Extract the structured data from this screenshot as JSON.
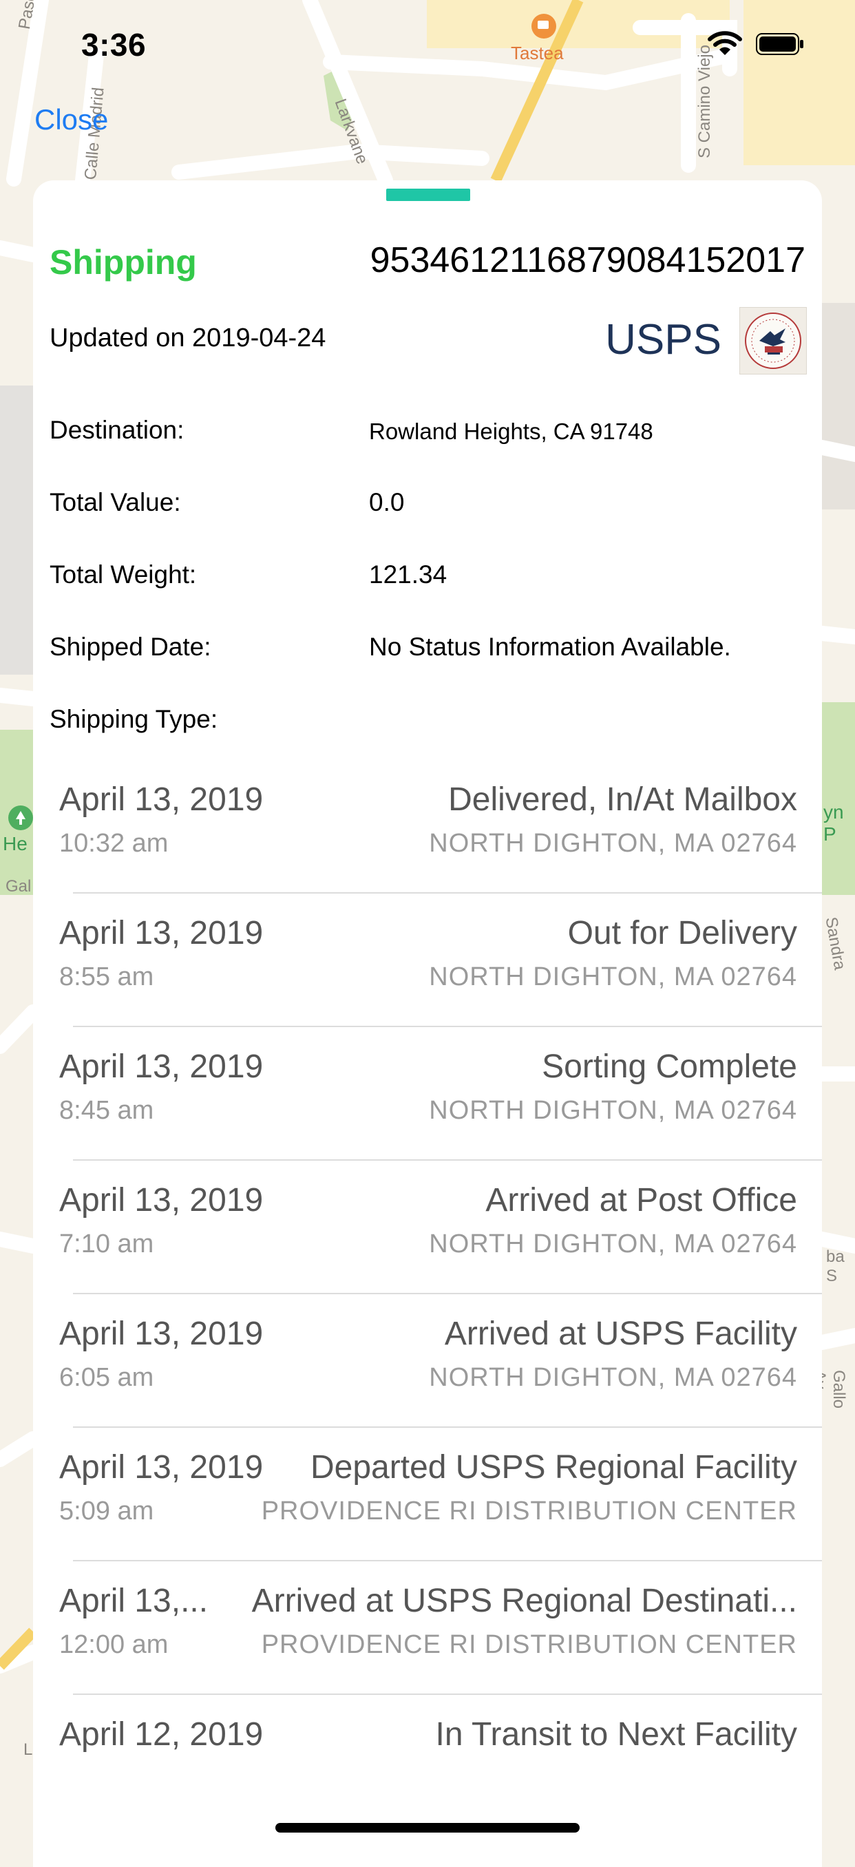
{
  "status_bar": {
    "time": "3:36"
  },
  "map": {
    "labels": [
      "Paseo Azul",
      "Calle Madrid",
      "Larkvane",
      "Tastea",
      "S Camino Viejo",
      "He",
      "Gal",
      "yn P",
      "Sandra Glen Dr",
      "ba S",
      "Gallo Av",
      "L"
    ]
  },
  "nav": {
    "close_label": "Close"
  },
  "shipment": {
    "status": "Shipping",
    "tracking_number": "9534612116879084152017",
    "updated": "Updated on 2019-04-24",
    "carrier": "USPS",
    "carrier_logo_icon": "usps-eagle-seal-icon",
    "details": [
      {
        "label": "Destination:",
        "value": "Rowland Heights, CA 91748"
      },
      {
        "label": "Total Value:",
        "value": "0.0"
      },
      {
        "label": "Total Weight:",
        "value": "121.34"
      },
      {
        "label": "Shipped Date:",
        "value": "No Status Information Available."
      },
      {
        "label": "Shipping Type:",
        "value": ""
      }
    ]
  },
  "events": [
    {
      "date": "April 13, 2019",
      "time": "10:32 am",
      "status": "Delivered, In/At Mailbox",
      "location": "NORTH DIGHTON, MA 02764"
    },
    {
      "date": "April 13, 2019",
      "time": "8:55 am",
      "status": "Out for Delivery",
      "location": "NORTH DIGHTON, MA 02764"
    },
    {
      "date": "April 13, 2019",
      "time": "8:45 am",
      "status": "Sorting Complete",
      "location": "NORTH DIGHTON, MA 02764"
    },
    {
      "date": "April 13, 2019",
      "time": "7:10 am",
      "status": "Arrived at Post Office",
      "location": "NORTH DIGHTON, MA 02764"
    },
    {
      "date": "April 13, 2019",
      "time": "6:05 am",
      "status": "Arrived at USPS Facility",
      "location": "NORTH DIGHTON, MA 02764"
    },
    {
      "date": "April 13, 2019",
      "time": "5:09 am",
      "status": "Departed USPS Regional Facility",
      "location": "PROVIDENCE RI DISTRIBUTION CENTER"
    },
    {
      "date": "April 13,...",
      "time": "12:00 am",
      "status": "Arrived at USPS Regional Destinati...",
      "location": "PROVIDENCE RI DISTRIBUTION CENTER"
    },
    {
      "date": "April 12, 2019",
      "time": "",
      "status": "In Transit to Next Facility",
      "location": ""
    }
  ],
  "colors": {
    "status_green": "#34c94a",
    "accent_blue": "#1e7cf2",
    "handle_teal": "#1fc6a6",
    "usps_navy": "#1e3358"
  }
}
